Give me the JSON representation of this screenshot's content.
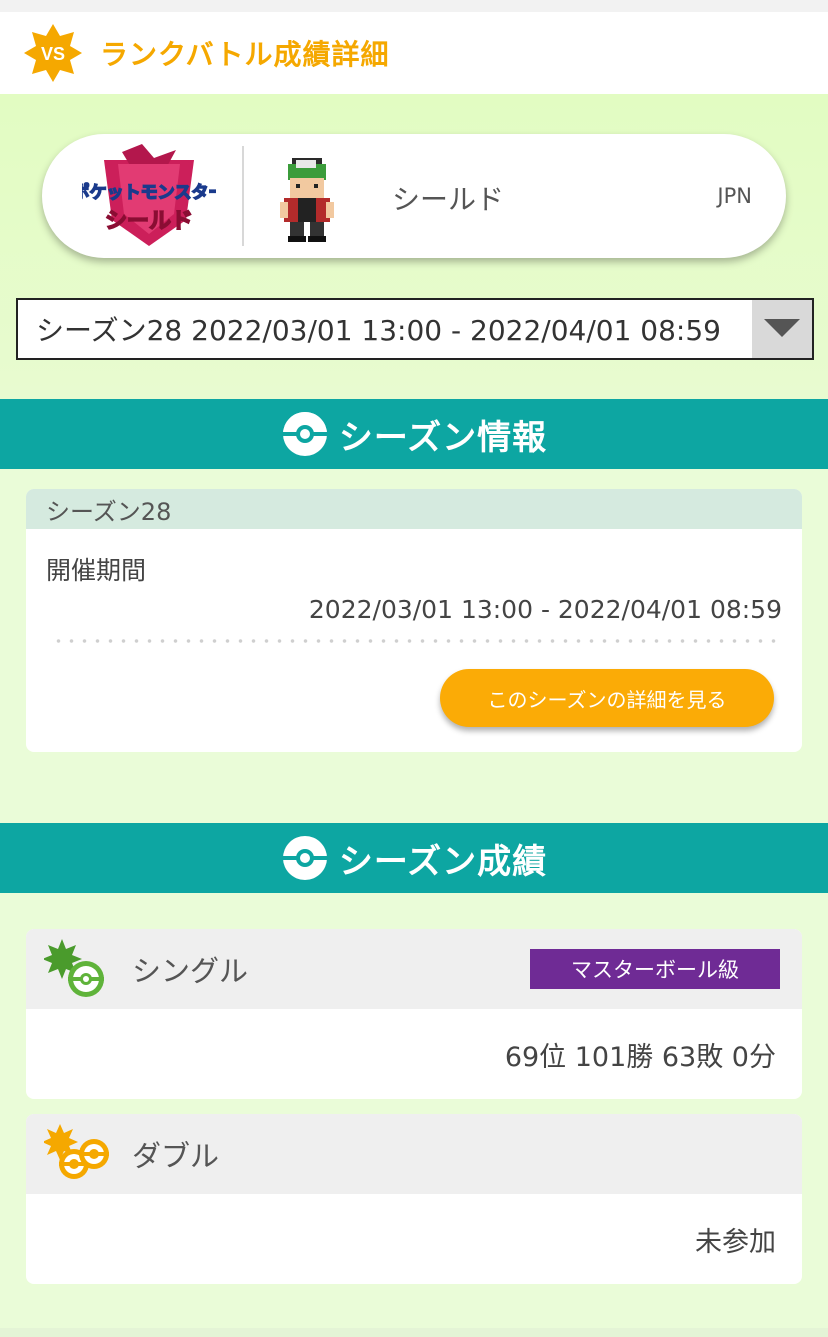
{
  "header": {
    "badge_text": "VS",
    "title": "ランクバトル成績詳細"
  },
  "profile": {
    "logo_line1": "ポケットモンスター",
    "logo_line2": "シールド",
    "game_name": "シールド",
    "region": "JPN"
  },
  "season_select": {
    "selected": "シーズン28 2022/03/01 13:00 - 2022/04/01 08:59"
  },
  "season_info": {
    "section_title": "シーズン情報",
    "card_title": "シーズン28",
    "period_label": "開催期間",
    "period_value": "2022/03/01 13:00 - 2022/04/01 08:59",
    "detail_button": "このシーズンの詳細を見る"
  },
  "season_results": {
    "section_title": "シーズン成績",
    "single": {
      "name": "シングル",
      "rank_badge": "マスターボール級",
      "result": "69位 101勝 63敗 0分"
    },
    "double": {
      "name": "ダブル",
      "result": "未参加"
    }
  },
  "colors": {
    "accent_orange": "#f5a800",
    "teal": "#0da6a2",
    "master_purple": "#6f2b95",
    "button_orange": "#fbab06"
  }
}
